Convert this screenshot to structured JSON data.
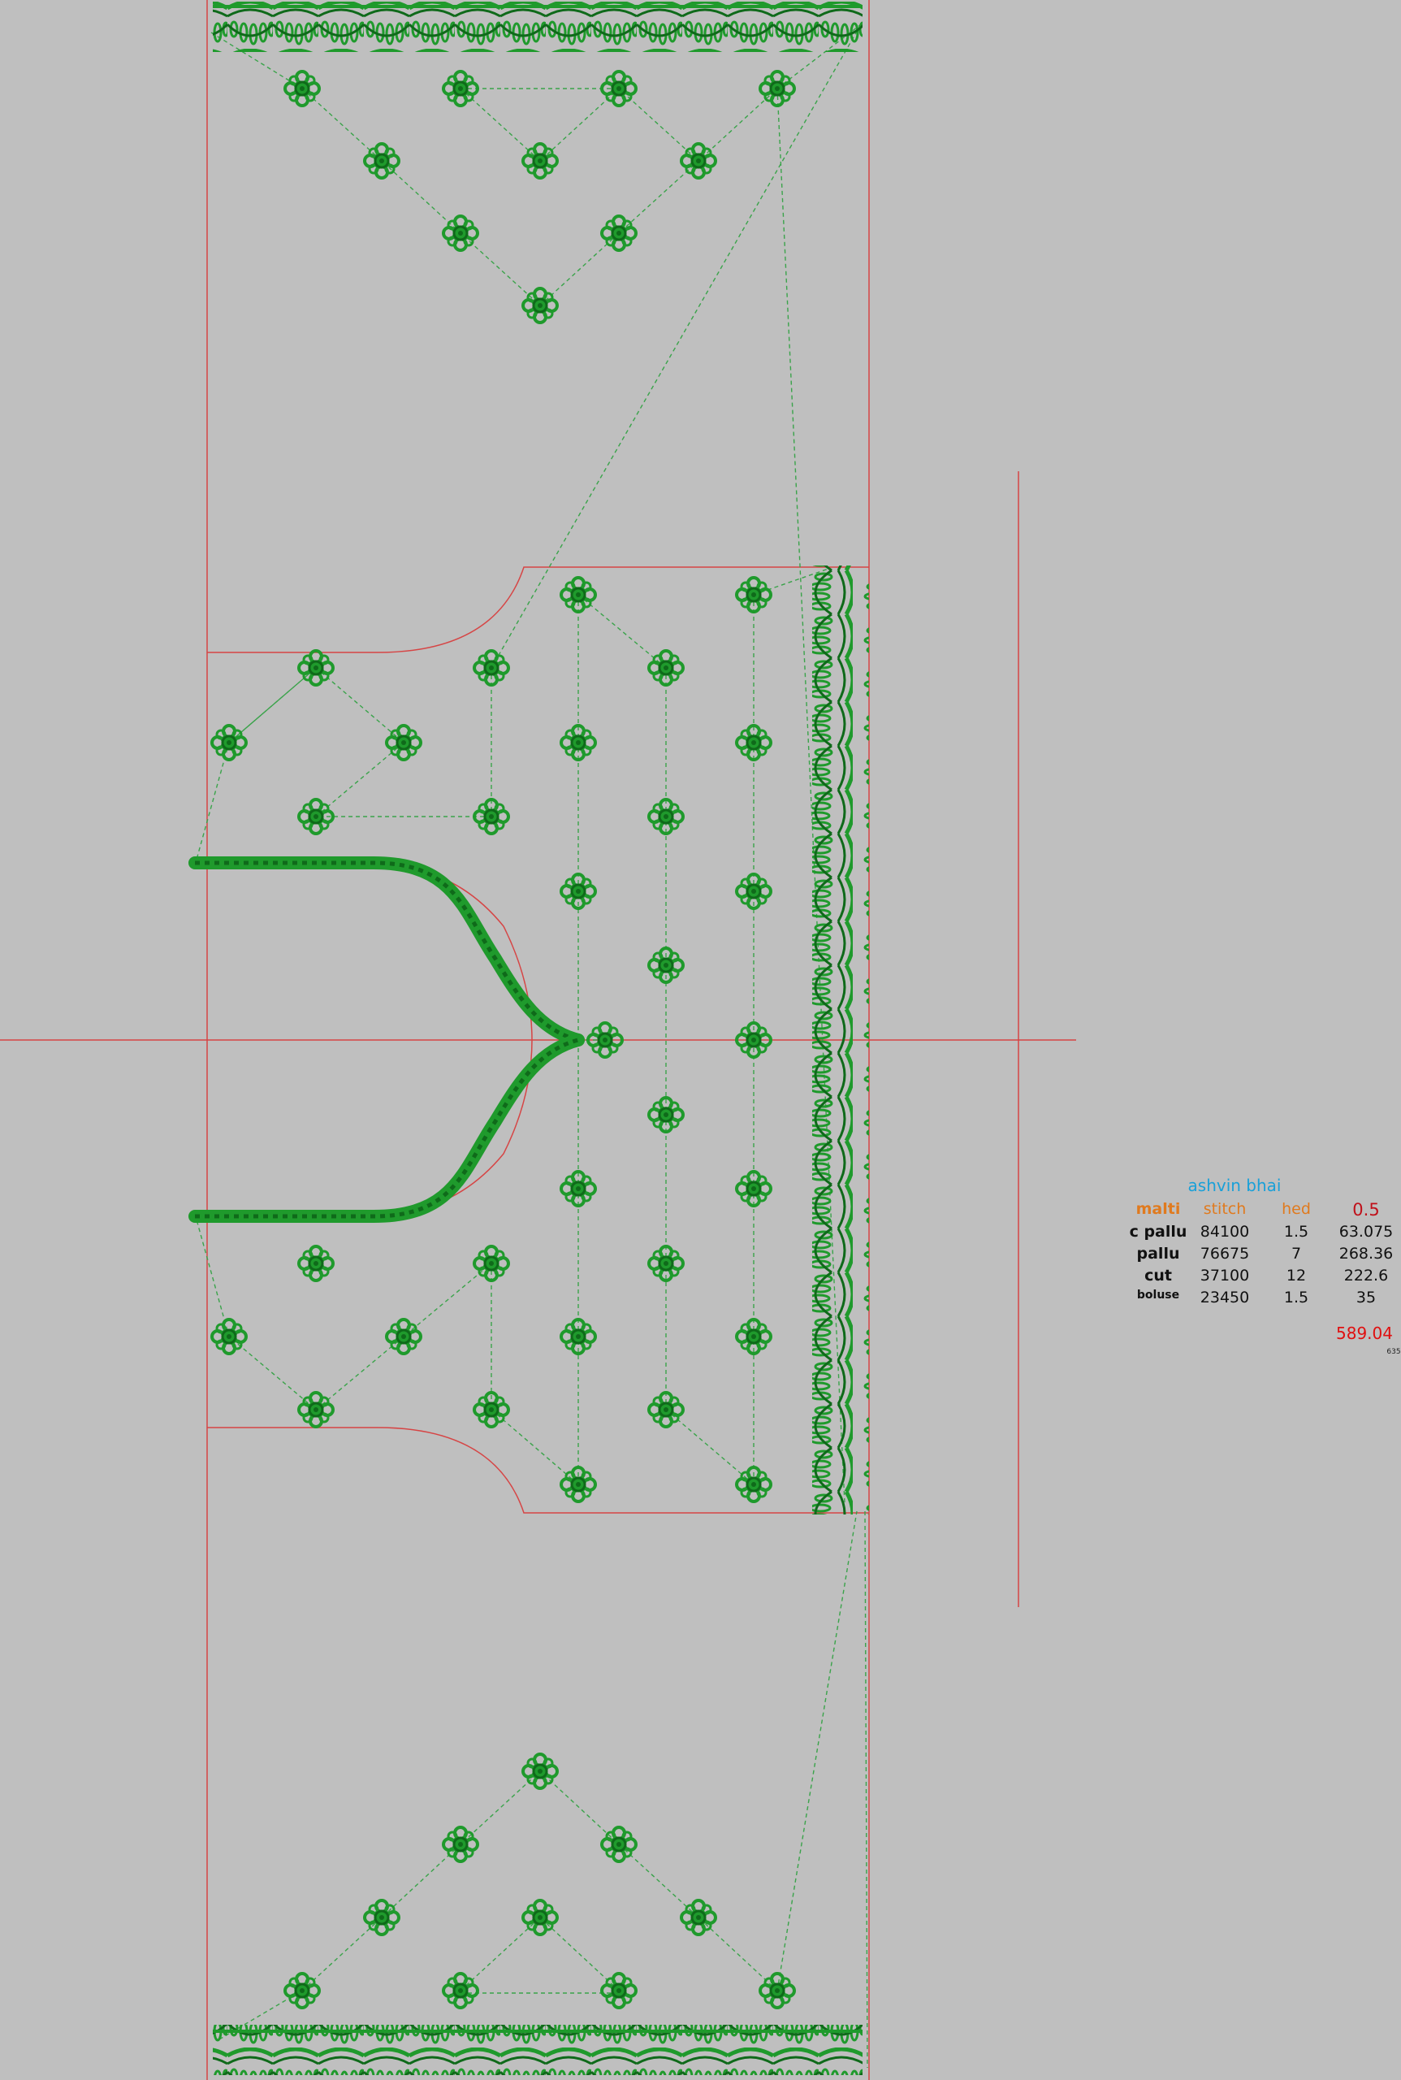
{
  "colors": {
    "background": "#bfbfbf",
    "guide_line": "#d64545",
    "stitch": "#1f9a2c",
    "stitch_dark": "#0f6a1a",
    "jump_line": "#3aa34a",
    "title": "#1aa0d8",
    "header": "#e07a1e",
    "rate": "#c0101a",
    "total": "#e01010",
    "text": "#111111"
  },
  "icons": {
    "motif": "flower-motif-icon",
    "border": "scallop-border-icon"
  },
  "info_table": {
    "title": "ashvin bhai",
    "headers": {
      "name": "malti",
      "stitch": "stitch",
      "head": "hed",
      "rate": "0.5"
    },
    "rows": [
      {
        "name": "c pallu",
        "stitch": "84100",
        "head": "1.5",
        "value": "63.075"
      },
      {
        "name": "pallu",
        "stitch": "76675",
        "head": "7",
        "value": "268.36"
      },
      {
        "name": "cut",
        "stitch": "37100",
        "head": "12",
        "value": "222.6"
      },
      {
        "name": "boluse",
        "stitch": "23450",
        "head": "1.5",
        "value": "35"
      }
    ],
    "total": "589.04",
    "note": "635"
  }
}
